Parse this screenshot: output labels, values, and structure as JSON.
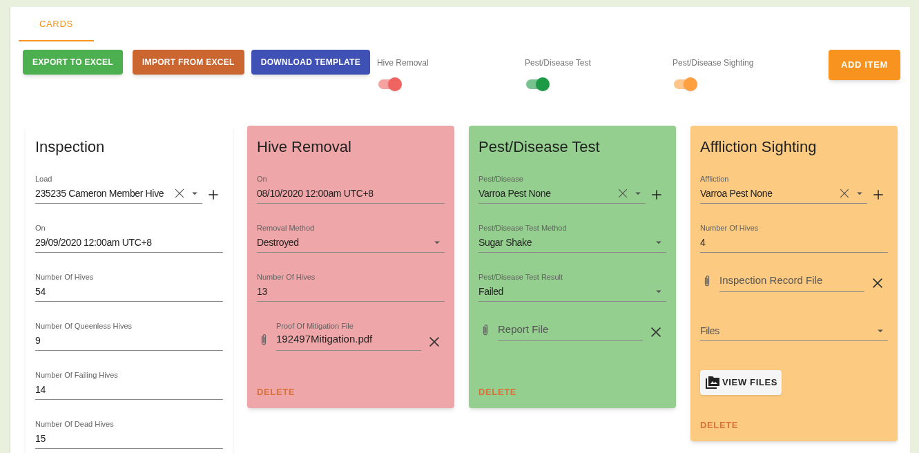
{
  "tabs": [
    {
      "label": "CARDS",
      "selected": true
    }
  ],
  "actions": [
    {
      "label": "EXPORT TO EXCEL",
      "color": "#4caf50"
    },
    {
      "label": "IMPORT FROM EXCEL",
      "color": "#cc6630"
    },
    {
      "label": "DOWNLOAD TEMPLATE",
      "color": "#3f51b5"
    }
  ],
  "toggles": [
    {
      "label": "Hive Removal",
      "on": true,
      "color": "#ef6461"
    },
    {
      "label": "Pest/Disease Test",
      "on": true,
      "color": "#1e9a44"
    },
    {
      "label": "Pest/Disease Sighting",
      "on": true,
      "color": "#ffa040"
    }
  ],
  "add_button": "ADD ITEM",
  "cards": [
    {
      "title": "Inspection",
      "color": "#ffffff",
      "fields": [
        {
          "kind": "autocomplete",
          "label": "Load",
          "value": "235235 Cameron Member Hive"
        },
        {
          "kind": "text",
          "label": "On",
          "value": "29/09/2020 12:00am UTC+8"
        },
        {
          "kind": "text",
          "label": "Number Of Hives",
          "value": "54"
        },
        {
          "kind": "text",
          "label": "Number Of Queenless Hives",
          "value": "9"
        },
        {
          "kind": "text",
          "label": "Number Of Failing Hives",
          "value": "14"
        },
        {
          "kind": "text",
          "label": "Number Of Dead Hives",
          "value": "15"
        }
      ]
    },
    {
      "title": "Hive Removal",
      "color": "#eea6a8",
      "fields": [
        {
          "kind": "text",
          "label": "On",
          "value": "08/10/2020 12:00am UTC+8"
        },
        {
          "kind": "select",
          "label": "Removal Method",
          "value": "Destroyed"
        },
        {
          "kind": "text",
          "label": "Number Of Hives",
          "value": "13"
        },
        {
          "kind": "file",
          "label": "Proof Of Mitigation File",
          "value": "192497Mitigation.pdf"
        }
      ],
      "delete": "DELETE"
    },
    {
      "title": "Pest/Disease Test",
      "color": "#94cf8f",
      "fields": [
        {
          "kind": "autocomplete",
          "label": "Pest/Disease",
          "value": "Varroa Pest None"
        },
        {
          "kind": "select",
          "label": "Pest/Disease Test Method",
          "value": "Sugar Shake"
        },
        {
          "kind": "select",
          "label": "Pest/Disease Test Result",
          "value": "Failed"
        },
        {
          "kind": "file",
          "placeholder": "Report File"
        }
      ],
      "delete": "DELETE"
    },
    {
      "title": "Affliction Sighting",
      "color": "#fcca80",
      "fields": [
        {
          "kind": "autocomplete",
          "label": "Affliction",
          "value": "Varroa Pest None"
        },
        {
          "kind": "text",
          "label": "Number Of Hives",
          "value": "4"
        },
        {
          "kind": "file",
          "placeholder": "Inspection Record File"
        },
        {
          "kind": "select",
          "placeholder": "Files"
        },
        {
          "kind": "button",
          "label": "VIEW FILES"
        }
      ],
      "delete": "DELETE"
    }
  ]
}
